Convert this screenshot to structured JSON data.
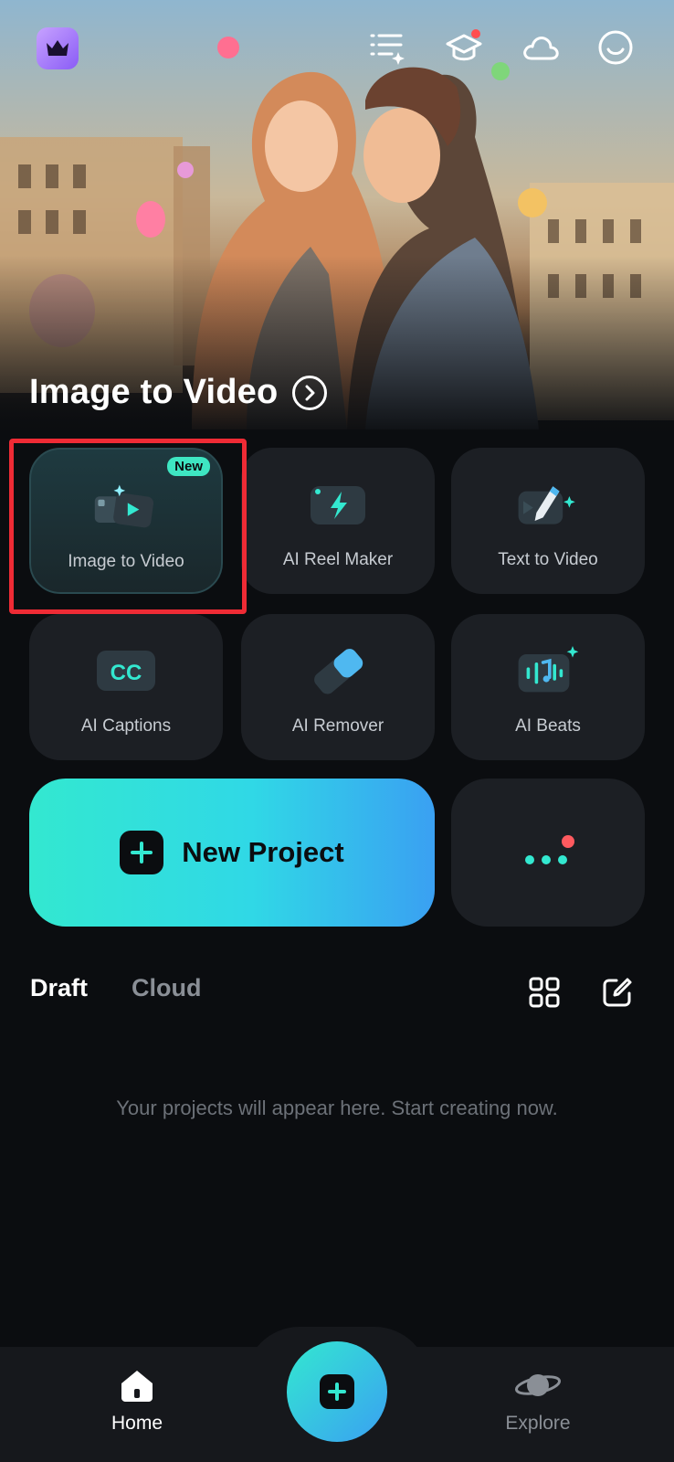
{
  "hero": {
    "title": "Image to Video"
  },
  "tools": [
    {
      "label": "Image to Video",
      "icon": "image-to-video-icon",
      "badge": "New"
    },
    {
      "label": "AI Reel Maker",
      "icon": "lightning-icon"
    },
    {
      "label": "Text to Video",
      "icon": "pencil-sparkle-icon"
    },
    {
      "label": "AI Captions",
      "icon": "cc-icon"
    },
    {
      "label": "AI Remover",
      "icon": "eraser-icon"
    },
    {
      "label": "AI Beats",
      "icon": "music-beats-icon"
    }
  ],
  "new_project": {
    "label": "New Project"
  },
  "tabs": {
    "draft": "Draft",
    "cloud": "Cloud"
  },
  "empty_state": "Your projects will appear here. Start creating now.",
  "nav": {
    "home": "Home",
    "explore": "Explore"
  },
  "colors": {
    "accent": "#33e8d0",
    "accent2": "#3aa0f2",
    "highlight": "#ef2b35",
    "badge": "#3ee6c2"
  }
}
